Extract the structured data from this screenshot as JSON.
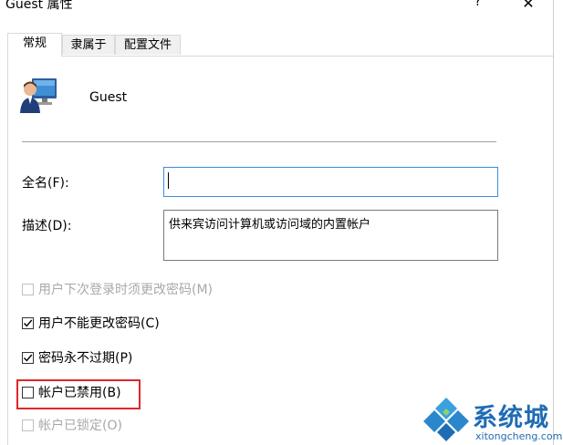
{
  "window": {
    "title": "Guest 属性",
    "help_label": "?",
    "close_label": "✕"
  },
  "tabs": [
    {
      "label": "常规",
      "active": true
    },
    {
      "label": "隶属于",
      "active": false
    },
    {
      "label": "配置文件",
      "active": false
    }
  ],
  "user": {
    "name": "Guest",
    "icon": "user-computer-icon"
  },
  "form": {
    "fullname_label": "全名(F):",
    "fullname_value": "",
    "description_label": "描述(D):",
    "description_value": "供来宾访问计算机或访问域的内置帐户"
  },
  "options": [
    {
      "label": "用户下次登录时须更改密码(M)",
      "checked": false,
      "enabled": false
    },
    {
      "label": "用户不能更改密码(C)",
      "checked": true,
      "enabled": true
    },
    {
      "label": "密码永不过期(P)",
      "checked": true,
      "enabled": true
    },
    {
      "label": "帐户已禁用(B)",
      "checked": false,
      "enabled": true,
      "highlighted": true
    },
    {
      "label": "帐户已锁定(O)",
      "checked": false,
      "enabled": false
    }
  ],
  "watermark": {
    "text": "系统城",
    "url": "xitongcheng.com"
  },
  "colors": {
    "highlight_border": "#e0262b",
    "focus_border": "#3c8dd9",
    "watermark_blue": "#1e6cb4"
  }
}
